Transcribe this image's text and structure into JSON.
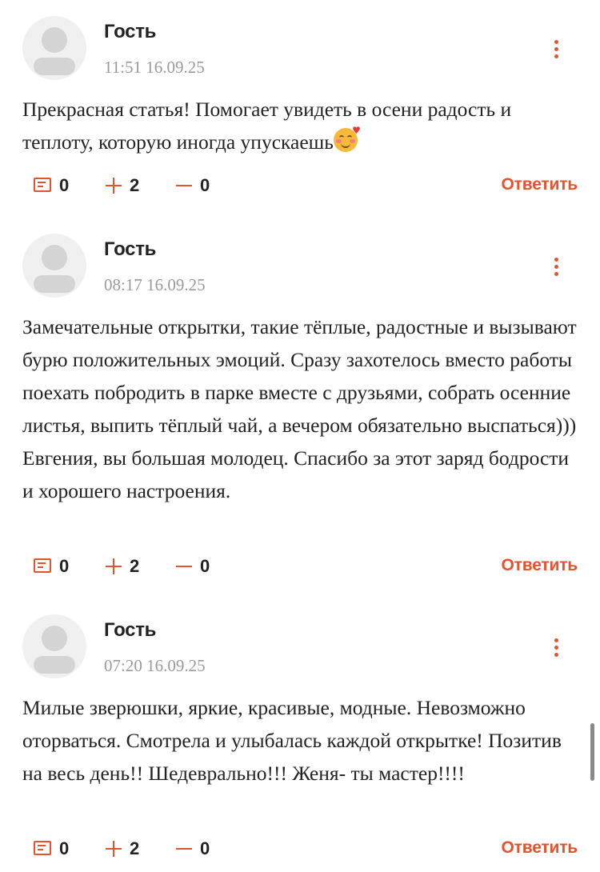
{
  "comments": [
    {
      "author": "Гость",
      "timestamp": "11:51 16.09.25",
      "text": "Прекрасная статья! Помогает увидеть в осени радость и теплоту, которую иногда упускаешь",
      "emoji": "smiling-face-with-hearts",
      "replies": "0",
      "upvotes": "2",
      "downvotes": "0",
      "reply_label": "Ответить"
    },
    {
      "author": "Гость",
      "timestamp": "08:17 16.09.25",
      "text": "Замечательные открытки, такие тёплые, радостные и вызывают бурю положительных эмоций. Сразу захотелось вместо работы поехать побродить в парке вместе с друзьями, собрать осенние листья, выпить тёплый чай, а вечером обязательно выспаться))) Евгения, вы большая молодец. Спасибо за этот заряд бодрости и хорошего настроения.",
      "replies": "0",
      "upvotes": "2",
      "downvotes": "0",
      "reply_label": "Ответить"
    },
    {
      "author": "Гость",
      "timestamp": "07:20 16.09.25",
      "text": "Милые зверюшки, яркие, красивые, модные. Невозможно оторваться. Смотрела и улыбалась каждой открытке! Позитив на весь день!! Шедеврально!!! Женя- ты мастер!!!!",
      "replies": "0",
      "upvotes": "2",
      "downvotes": "0",
      "reply_label": "Ответить"
    }
  ],
  "icons": {
    "menu": "more-vertical-icon",
    "replies": "comment-icon",
    "upvote": "plus-icon",
    "downvote": "minus-icon"
  },
  "colors": {
    "accent": "#e5532d",
    "text": "#222222",
    "muted": "#9a9a9a",
    "avatar_bg": "#f0f0f0"
  }
}
